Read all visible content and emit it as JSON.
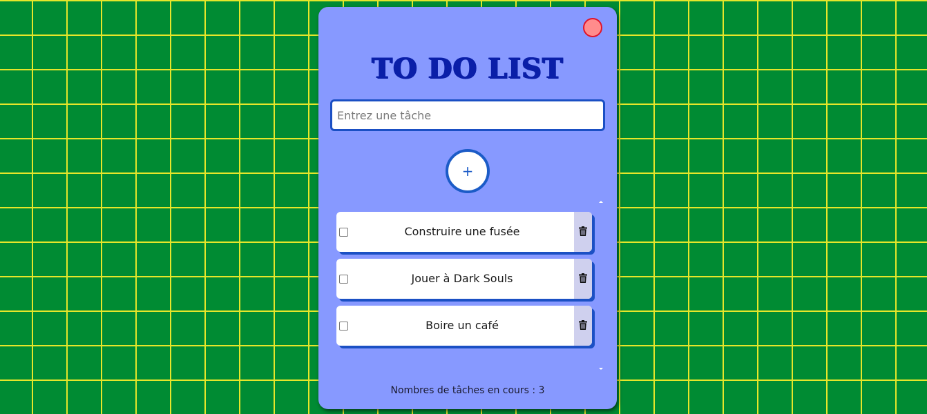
{
  "app": {
    "title": "TO DO LIST",
    "close_icon": "close-circle-icon"
  },
  "input": {
    "placeholder": "Entrez une tâche",
    "value": ""
  },
  "add_button": {
    "label": "+"
  },
  "tasks": [
    {
      "label": "Construire une fusée",
      "checked": false
    },
    {
      "label": "Jouer à Dark Souls",
      "checked": false
    },
    {
      "label": "Boire un café",
      "checked": false
    }
  ],
  "footer": {
    "counter_text": "Nombres de tâches en cours : 3"
  },
  "colors": {
    "background": "#008b33",
    "grid_lines": "#e6e62a",
    "card": "#8799ff",
    "title": "#0a1fa8",
    "accent": "#1b5bc7",
    "close_button": "#ff8c8c",
    "delete_panel": "#cfd0ee"
  }
}
